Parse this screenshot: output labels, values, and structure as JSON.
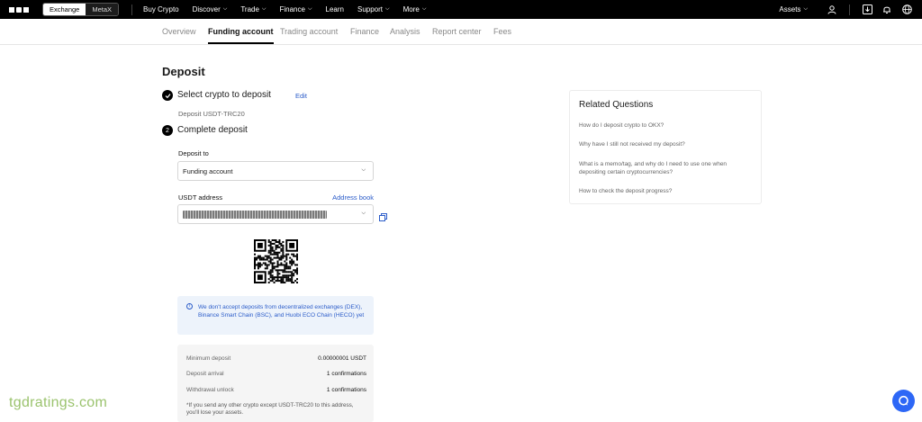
{
  "topnav": {
    "toggle": {
      "exchange": "Exchange",
      "metax": "MetaX"
    },
    "items": [
      {
        "label": "Buy Crypto",
        "chevron": false
      },
      {
        "label": "Discover",
        "chevron": true
      },
      {
        "label": "Trade",
        "chevron": true
      },
      {
        "label": "Finance",
        "chevron": true
      },
      {
        "label": "Learn",
        "chevron": false
      },
      {
        "label": "Support",
        "chevron": true
      },
      {
        "label": "More",
        "chevron": true
      }
    ],
    "assets": "Assets",
    "icons": [
      "user-icon",
      "download-icon",
      "bell-icon",
      "globe-icon"
    ]
  },
  "subnav": {
    "tabs": [
      {
        "label": "Overview",
        "active": false
      },
      {
        "label": "Funding account",
        "active": true
      },
      {
        "label": "Trading account",
        "active": false
      },
      {
        "label": "Finance",
        "active": false
      },
      {
        "label": "Analysis",
        "active": false
      },
      {
        "label": "Report center",
        "active": false
      },
      {
        "label": "Fees",
        "active": false
      }
    ]
  },
  "deposit": {
    "title": "Deposit",
    "step1": {
      "title": "Select crypto to deposit",
      "edit": "Edit",
      "selected": "Deposit USDT-TRC20"
    },
    "step2": {
      "number": "2",
      "title": "Complete deposit"
    },
    "deposit_to_label": "Deposit to",
    "deposit_to_value": "Funding account",
    "address_label": "USDT address",
    "address_book": "Address book",
    "notice": "We don't accept deposits from decentralized exchanges (DEX), Binance Smart Chain (BSC), and Huobi ECO Chain (HECO) yet",
    "info": {
      "rows": [
        {
          "key": "Minimum deposit",
          "value": "0.00000001 USDT"
        },
        {
          "key": "Deposit arrival",
          "value": "1 confirmations"
        },
        {
          "key": "Withdrawal unlock",
          "value": "1 confirmations"
        }
      ],
      "warning": "*If you send any other crypto except USDT-TRC20 to this address, you'll lose your assets."
    }
  },
  "related": {
    "title": "Related Questions",
    "questions": [
      "How do I deposit crypto to OKX?",
      "Why have I still not received my deposit?",
      "What is a memo/tag, and why do I need to use one when depositing certain cryptocurrencies?",
      "How to check the deposit progress?"
    ]
  },
  "watermark": "tgdratings.com",
  "colors": {
    "accent": "#2b5cc9",
    "chat": "#2d67f6",
    "notice_bg": "#edf3fb"
  }
}
